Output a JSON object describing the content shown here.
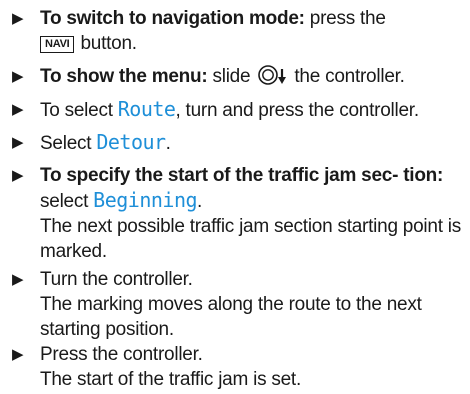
{
  "steps": [
    {
      "bold": "To switch to navigation mode:",
      "text_before": "press the",
      "keycap": "NAVI",
      "text_after": "button."
    },
    {
      "bold": "To show the menu:",
      "text_before": "slide",
      "icon": "controller-slide-down-icon",
      "text_after": "the controller."
    },
    {
      "text_before": "To select",
      "display": "Route",
      "text_after": ", turn and press the controller."
    },
    {
      "text_before": "Select",
      "display": "Detour",
      "text_after": "."
    },
    {
      "bold": "To specify the start of the traffic jam sec- tion:",
      "text_before": "select",
      "display": "Beginning",
      "text_after": ".",
      "result": "The next possible traffic jam section starting point is marked."
    },
    {
      "text": "Turn the controller.",
      "result": "The marking moves along the route to the next starting position."
    },
    {
      "text": "Press the controller.",
      "result": "The start of the traffic jam is set."
    }
  ],
  "colors": {
    "text": "#1a1a1a",
    "display_text": "#1e8fd8"
  }
}
